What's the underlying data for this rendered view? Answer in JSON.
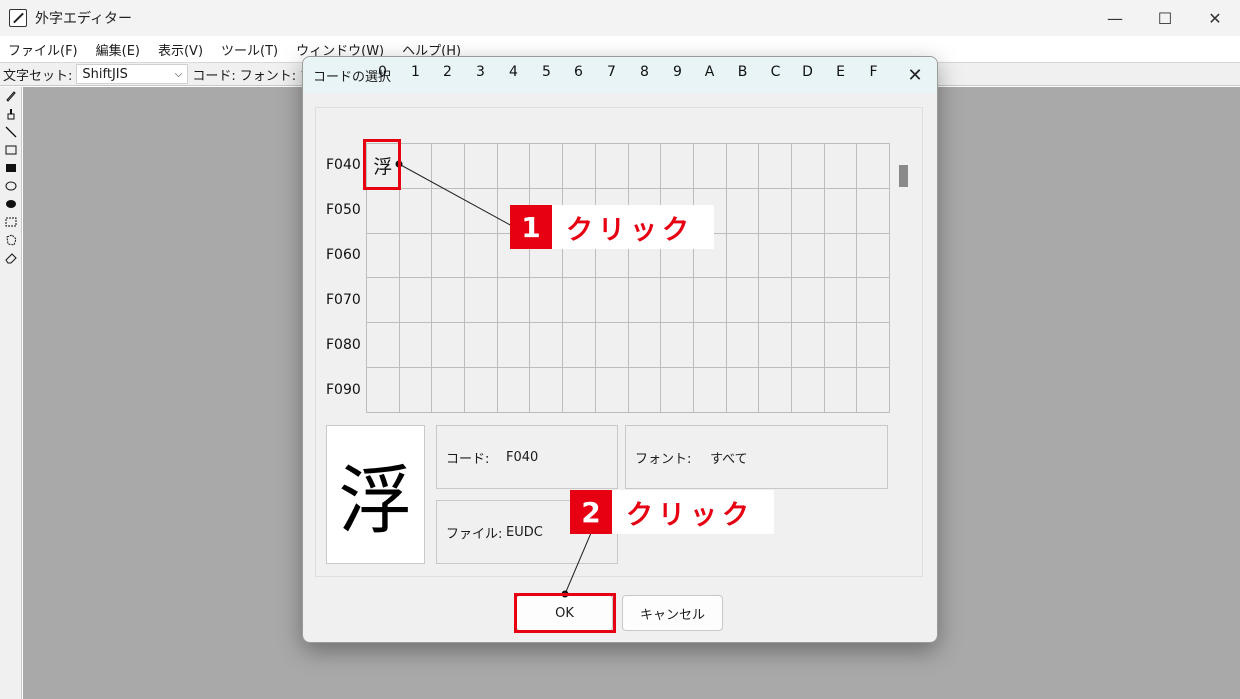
{
  "window": {
    "title": "外字エディター",
    "minimize_glyph": "—",
    "maximize_glyph": "☐",
    "close_glyph": "✕"
  },
  "menu": [
    "ファイル(F)",
    "編集(E)",
    "表示(V)",
    "ツール(T)",
    "ウィンドウ(W)",
    "ヘルプ(H)"
  ],
  "toolbar": {
    "charset_label": "文字セット:",
    "charset_value": "ShiftJIS",
    "code_label": "コード:",
    "font_label": "フォント: すべ"
  },
  "tools": [
    "pencil-icon",
    "brush-icon",
    "line-icon",
    "hollow-rectangle-icon",
    "filled-rectangle-icon",
    "hollow-ellipse-icon",
    "filled-ellipse-icon",
    "rectangular-selection-icon",
    "freeform-selection-icon",
    "eraser-icon"
  ],
  "dialog": {
    "title": "コードの選択",
    "close_glyph": "✕",
    "columns": [
      "0",
      "1",
      "2",
      "3",
      "4",
      "5",
      "6",
      "7",
      "8",
      "9",
      "A",
      "B",
      "C",
      "D",
      "E",
      "F"
    ],
    "rows": [
      "F040",
      "F050",
      "F060",
      "F070",
      "F080",
      "F090"
    ],
    "selected_char": "浮",
    "preview_char": "浮",
    "code_label": "コード:",
    "code_value": "F040",
    "font_label": "フォント:",
    "font_value": "すべて",
    "file_label": "ファイル:",
    "file_value": "EUDC",
    "ok_label": "OK",
    "cancel_label": "キャンセル"
  },
  "annotations": {
    "step1_number": "1",
    "step1_text": "クリック",
    "step2_number": "2",
    "step2_text": "クリック",
    "accent_color": "#e60012"
  }
}
